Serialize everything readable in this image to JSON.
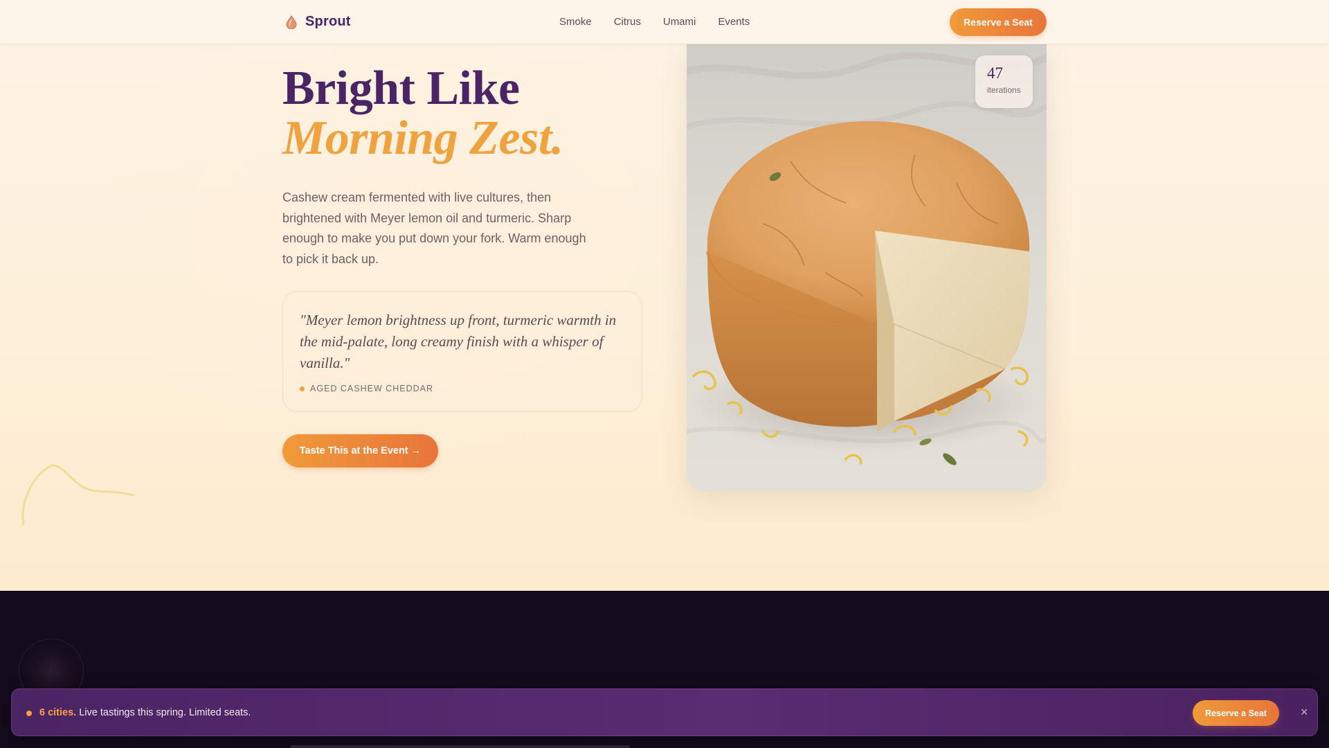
{
  "nav": {
    "brand": "Sprout",
    "links": [
      "Smoke",
      "Citrus",
      "Umami",
      "Events"
    ],
    "cta": "Reserve a Seat"
  },
  "hero": {
    "title_line1": "Bright Like",
    "title_line2": "Morning Zest.",
    "description": "Cashew cream fermented with live cultures, then brightened with Meyer lemon oil and turmeric. Sharp enough to make you put down your fork. Warm enough to pick it back up.",
    "quote": "\"Meyer lemon brightness up front, turmeric warmth in the mid-palate, long creamy finish with a whisper of vanilla.\"",
    "quote_source": "AGED CASHEW CHEDDAR",
    "cta": "Taste This at the Event →"
  },
  "badge": {
    "number": "47",
    "label": "iterations"
  },
  "promo": {
    "highlight": "6 cities.",
    "text": " Live tastings this spring. Limited seats.",
    "cta": "Reserve a Seat",
    "close": "×"
  },
  "colors": {
    "brand_purple": "#4b2466",
    "accent_orange": "#f0a23e",
    "cta_gradient_start": "#f09a3a",
    "cta_gradient_end": "#e8753a",
    "dark_bg": "#140b1c"
  },
  "icons": {
    "logo": "sprout-drop-icon",
    "close": "close-icon"
  }
}
